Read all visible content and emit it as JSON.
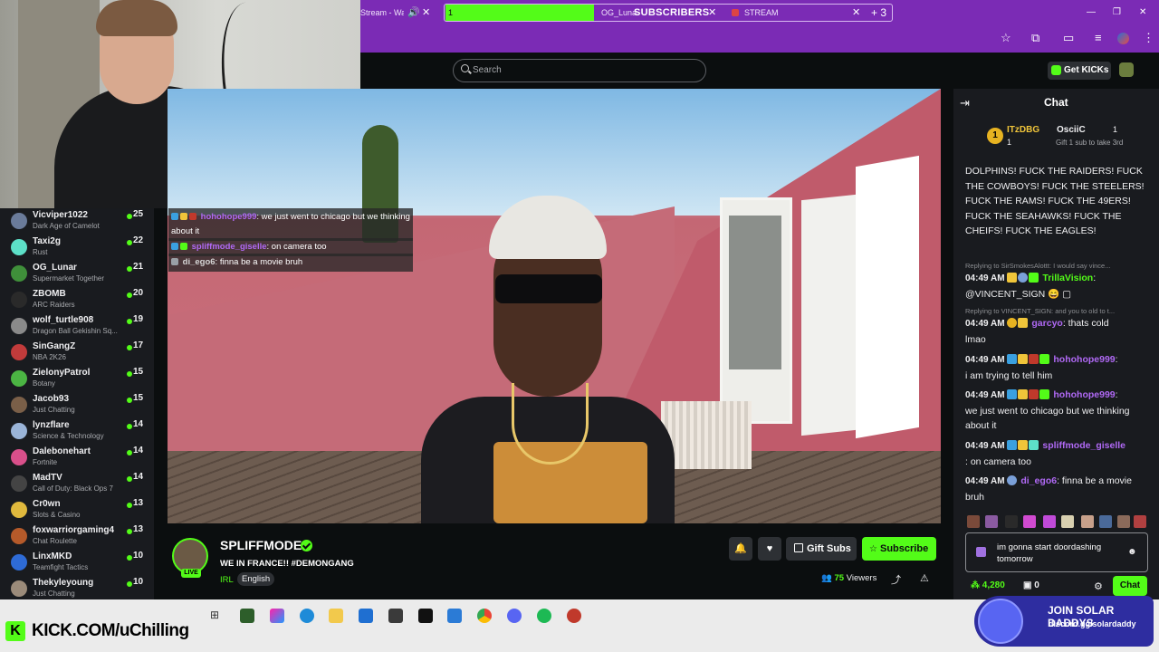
{
  "browser": {
    "tabs": [
      {
        "label": "Stream - Wat"
      },
      {
        "label": "1"
      },
      {
        "label": "OG_Lunar"
      },
      {
        "label": "STREAM"
      }
    ],
    "tab_group_banner": "SUBSCRIBERS",
    "new_tab_count": "3"
  },
  "site": {
    "search_placeholder": "Search",
    "get_kicks_label": "Get KICKs"
  },
  "sidebar": {
    "channels": [
      {
        "name": "Vicviper1022",
        "category": "Dark Age of Camelot",
        "viewers": "25",
        "color": "#6a7b9a"
      },
      {
        "name": "Taxi2g",
        "category": "Rust",
        "viewers": "22",
        "color": "#5de0c8"
      },
      {
        "name": "OG_Lunar",
        "category": "Supermarket Together",
        "viewers": "21",
        "color": "#3f8f3a"
      },
      {
        "name": "ZBOMB",
        "category": "ARC Raiders",
        "viewers": "20",
        "color": "#2a2a2a"
      },
      {
        "name": "wolf_turtle908",
        "category": "Dragon Ball Gekishin Sq...",
        "viewers": "19",
        "color": "#8a8a8a"
      },
      {
        "name": "SinGangZ",
        "category": "NBA 2K26",
        "viewers": "17",
        "color": "#c23b3b"
      },
      {
        "name": "ZielonyPatrol",
        "category": "Botany",
        "viewers": "15",
        "color": "#4bb543"
      },
      {
        "name": "Jacob93",
        "category": "Just Chatting",
        "viewers": "15",
        "color": "#7a5f48"
      },
      {
        "name": "lynzflare",
        "category": "Science & Technology",
        "viewers": "14",
        "color": "#9ab4d8"
      },
      {
        "name": "Dalebonehart",
        "category": "Fortnite",
        "viewers": "14",
        "color": "#d94f8a"
      },
      {
        "name": "MadTV",
        "category": "Call of Duty: Black Ops 7",
        "viewers": "14",
        "color": "#444444"
      },
      {
        "name": "Cr0wn",
        "category": "Slots & Casino",
        "viewers": "13",
        "color": "#e0b93d"
      },
      {
        "name": "foxwarriorgaming4",
        "category": "Chat Roulette",
        "viewers": "13",
        "color": "#b55a2a"
      },
      {
        "name": "LinxMKD",
        "category": "Teamfight Tactics",
        "viewers": "10",
        "color": "#2e6bd6"
      },
      {
        "name": "Thekyleyoung",
        "category": "Just Chatting",
        "viewers": "10",
        "color": "#9b8b7a"
      }
    ]
  },
  "overlay_chat": [
    {
      "user": "hohohope999",
      "text": ": we just went to chicago but we thinking about it",
      "color": "#b069f5"
    },
    {
      "user": "spliffmode_giselle",
      "text": ": on camera too",
      "color": "#b069f5"
    },
    {
      "user": "di_ego6",
      "text": ": finna be a movie bruh",
      "color": "#d6d6d6"
    }
  ],
  "channel": {
    "name": "SPLIFFMODE",
    "title": "WE IN FRANCE!! #DEMONGANG",
    "category": "IRL",
    "language": "English",
    "live_label": "LIVE",
    "viewers": "75",
    "viewers_label": "Viewers",
    "gift_subs_label": "Gift Subs",
    "subscribe_label": "Subscribe"
  },
  "chat": {
    "title": "Chat",
    "pinned": {
      "rank": "1",
      "user1": "ITzDBG",
      "user1_count": "1",
      "user2": "OsciiC",
      "user2_count": "1",
      "hint": "Gift 1 sub to take 3rd"
    },
    "top_text": "DOLPHINS! FUCK THE RAIDERS! FUCK THE COWBOYS! FUCK THE STEELERS! FUCK THE RAMS! FUCK THE 49ERS! FUCK THE SEAHAWKS! FUCK THE CHEIFS! FUCK THE EAGLES!",
    "messages": [
      {
        "reply": "Replying to SirSmokesAlottt: I would say vince...",
        "time": "04:49 AM",
        "user": "TrillaVision",
        "color": "#53fc18",
        "text": ":",
        "continuation": "@VINCENT_SIGN 😄 ▢"
      },
      {
        "reply": "Replying to VINCENT_SIGN: and you to old to t...",
        "time": "04:49 AM",
        "user": "garcyo",
        "color": "#b069f5",
        "text": ": thats cold",
        "continuation": "lmao"
      },
      {
        "reply": "",
        "time": "04:49 AM",
        "user": "hohohope999",
        "color": "#b069f5",
        "text": ":",
        "continuation": "i am trying to tell him"
      },
      {
        "reply": "",
        "time": "04:49 AM",
        "user": "hohohope999",
        "color": "#b069f5",
        "text": ":",
        "continuation": "we just went to chicago but we thinking about it"
      },
      {
        "reply": "",
        "time": "04:49 AM",
        "user": "spliffmode_giselle",
        "color": "#b069f5",
        "text": "",
        "continuation": ": on camera too"
      },
      {
        "reply": "",
        "time": "04:49 AM",
        "user": "di_ego6",
        "color": "#b069f5",
        "text": ": finna be a movie",
        "continuation": "bruh"
      }
    ],
    "input_text": "im gonna start  doordashing tomorrow",
    "points": "4,280",
    "gifts": "0",
    "send_label": "Chat"
  },
  "taskbar": {
    "kick_url": "KICK.COM/uChilling",
    "promo_title": "JOIN SOLAR DADDYS",
    "promo_url": "discord.gg/solardaddy"
  },
  "colors": {
    "kick_green": "#53fc18",
    "browser_purple": "#7b2bb5",
    "bg": "#0b0e0f",
    "panel": "#191b1f"
  }
}
